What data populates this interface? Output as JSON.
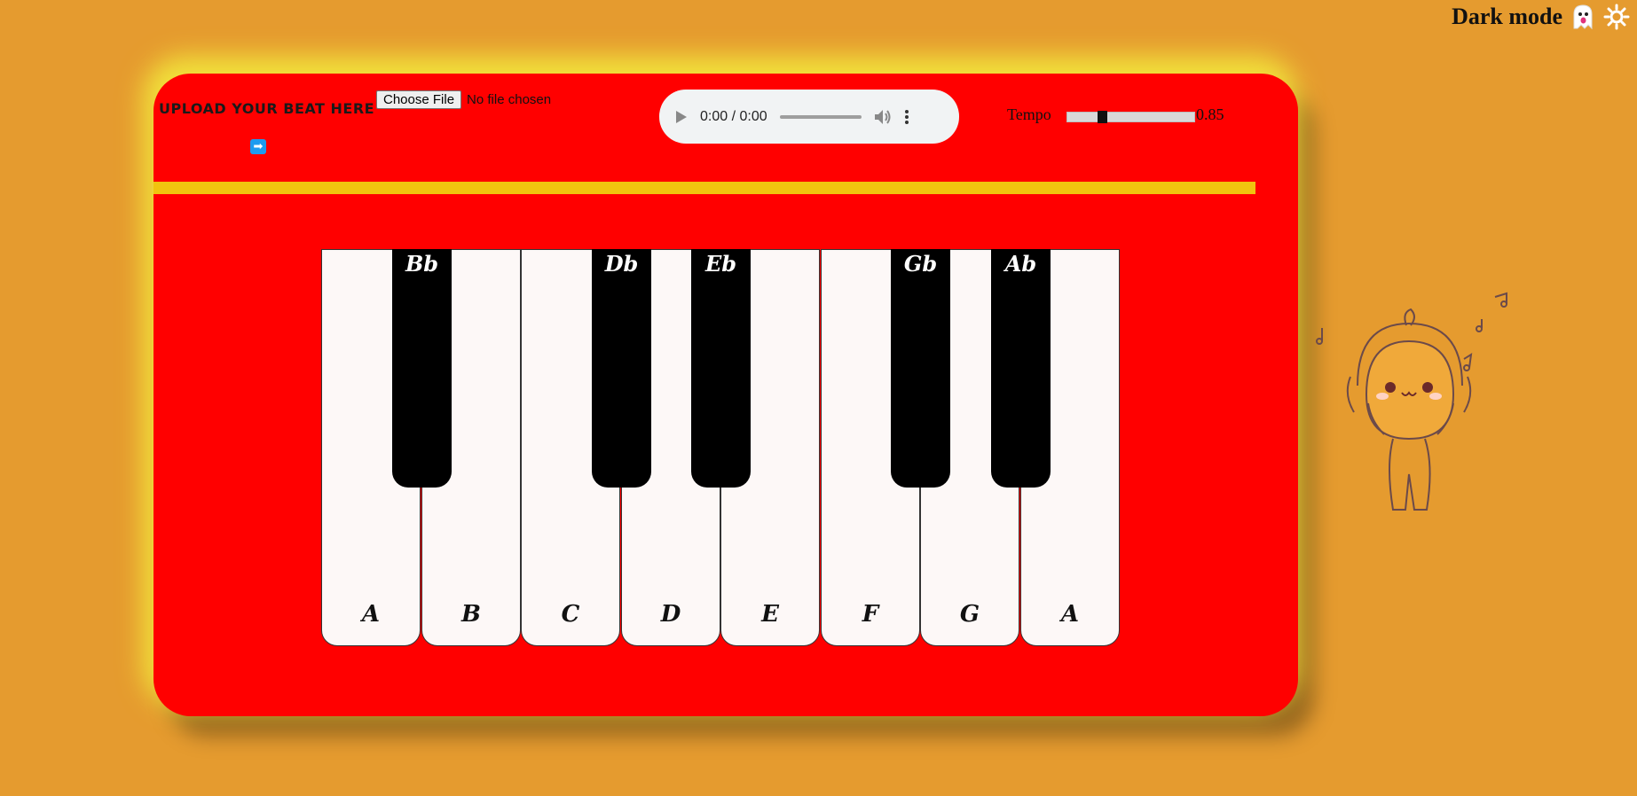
{
  "darkmode": {
    "label": "Dark mode"
  },
  "upload": {
    "label": "UPLOAD YOUR BEAT HERE",
    "choose_button": "Choose File",
    "file_status": "No file chosen",
    "submit_icon": "right-arrow-icon"
  },
  "audio": {
    "time": "0:00 / 0:00",
    "progress": 0
  },
  "tempo": {
    "label": "Tempo",
    "value": "0.85",
    "fraction": 0.25
  },
  "keys": {
    "white": [
      "A",
      "B",
      "C",
      "D",
      "E",
      "F",
      "G",
      "A"
    ],
    "black": [
      "Bb",
      "Db",
      "Eb",
      "Gb",
      "Ab"
    ]
  },
  "colors": {
    "background": "#e59b2f",
    "panel": "#ff0000",
    "bar": "#f1c40f",
    "white_key": "#fdf8f7",
    "black_key": "#000000"
  }
}
